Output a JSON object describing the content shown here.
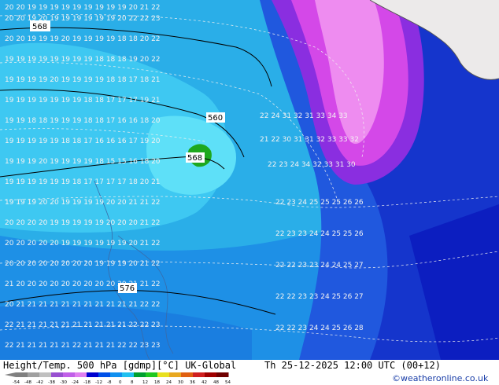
{
  "footer": {
    "title": "Height/Temp. 500 hPa [gdmp][°C] UK-Global",
    "valid_time": "Th 25-12-2025 12:00 UTC (00+12)",
    "credit": "©weatheronline.co.uk"
  },
  "colors": {
    "cyan_light": "#3fd8f5",
    "cyan": "#16bcea",
    "blue_mid": "#1e8ae8",
    "blue": "#2060e0",
    "blue_deep": "#0f28c8",
    "navy": "#0a18b8",
    "purple": "#9830e0",
    "magenta": "#d848e8",
    "pink": "#f090f0",
    "green": "#1fa81f",
    "land": "#ededed"
  },
  "height_labels": [
    "568",
    "560",
    "568",
    "576"
  ],
  "colorbar": {
    "ticks": [
      "-54",
      "-48",
      "-42",
      "-38",
      "-30",
      "-24",
      "-18",
      "-12",
      "-8",
      "0",
      "8",
      "12",
      "18",
      "24",
      "30",
      "36",
      "42",
      "48",
      "54"
    ],
    "colors": [
      "#808080",
      "#a0a0a0",
      "#c0c0c0",
      "#9850d0",
      "#c060e8",
      "#e080f0",
      "#0000d0",
      "#0050e8",
      "#1090f0",
      "#20c0f0",
      "#00a030",
      "#20c820",
      "#e8e020",
      "#e8a820",
      "#e06010",
      "#d02020",
      "#a00000",
      "#700000"
    ]
  }
}
